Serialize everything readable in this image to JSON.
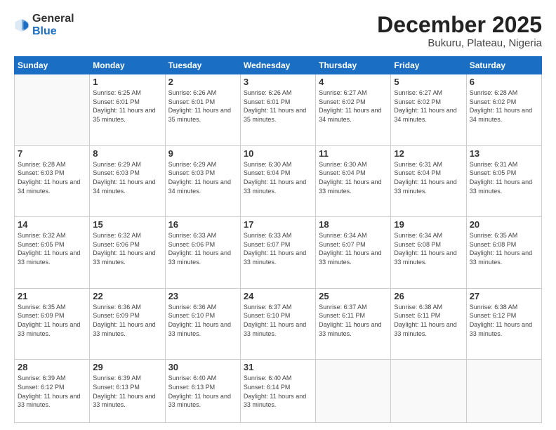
{
  "header": {
    "logo": {
      "text_general": "General",
      "text_blue": "Blue"
    },
    "title": "December 2025",
    "location": "Bukuru, Plateau, Nigeria"
  },
  "weekdays": [
    "Sunday",
    "Monday",
    "Tuesday",
    "Wednesday",
    "Thursday",
    "Friday",
    "Saturday"
  ],
  "weeks": [
    [
      {
        "day": "",
        "info": ""
      },
      {
        "day": "1",
        "info": "Sunrise: 6:25 AM\nSunset: 6:01 PM\nDaylight: 11 hours and 35 minutes."
      },
      {
        "day": "2",
        "info": "Sunrise: 6:26 AM\nSunset: 6:01 PM\nDaylight: 11 hours and 35 minutes."
      },
      {
        "day": "3",
        "info": "Sunrise: 6:26 AM\nSunset: 6:01 PM\nDaylight: 11 hours and 35 minutes."
      },
      {
        "day": "4",
        "info": "Sunrise: 6:27 AM\nSunset: 6:02 PM\nDaylight: 11 hours and 34 minutes."
      },
      {
        "day": "5",
        "info": "Sunrise: 6:27 AM\nSunset: 6:02 PM\nDaylight: 11 hours and 34 minutes."
      },
      {
        "day": "6",
        "info": "Sunrise: 6:28 AM\nSunset: 6:02 PM\nDaylight: 11 hours and 34 minutes."
      }
    ],
    [
      {
        "day": "7",
        "info": "Sunrise: 6:28 AM\nSunset: 6:03 PM\nDaylight: 11 hours and 34 minutes."
      },
      {
        "day": "8",
        "info": "Sunrise: 6:29 AM\nSunset: 6:03 PM\nDaylight: 11 hours and 34 minutes."
      },
      {
        "day": "9",
        "info": "Sunrise: 6:29 AM\nSunset: 6:03 PM\nDaylight: 11 hours and 34 minutes."
      },
      {
        "day": "10",
        "info": "Sunrise: 6:30 AM\nSunset: 6:04 PM\nDaylight: 11 hours and 33 minutes."
      },
      {
        "day": "11",
        "info": "Sunrise: 6:30 AM\nSunset: 6:04 PM\nDaylight: 11 hours and 33 minutes."
      },
      {
        "day": "12",
        "info": "Sunrise: 6:31 AM\nSunset: 6:04 PM\nDaylight: 11 hours and 33 minutes."
      },
      {
        "day": "13",
        "info": "Sunrise: 6:31 AM\nSunset: 6:05 PM\nDaylight: 11 hours and 33 minutes."
      }
    ],
    [
      {
        "day": "14",
        "info": "Sunrise: 6:32 AM\nSunset: 6:05 PM\nDaylight: 11 hours and 33 minutes."
      },
      {
        "day": "15",
        "info": "Sunrise: 6:32 AM\nSunset: 6:06 PM\nDaylight: 11 hours and 33 minutes."
      },
      {
        "day": "16",
        "info": "Sunrise: 6:33 AM\nSunset: 6:06 PM\nDaylight: 11 hours and 33 minutes."
      },
      {
        "day": "17",
        "info": "Sunrise: 6:33 AM\nSunset: 6:07 PM\nDaylight: 11 hours and 33 minutes."
      },
      {
        "day": "18",
        "info": "Sunrise: 6:34 AM\nSunset: 6:07 PM\nDaylight: 11 hours and 33 minutes."
      },
      {
        "day": "19",
        "info": "Sunrise: 6:34 AM\nSunset: 6:08 PM\nDaylight: 11 hours and 33 minutes."
      },
      {
        "day": "20",
        "info": "Sunrise: 6:35 AM\nSunset: 6:08 PM\nDaylight: 11 hours and 33 minutes."
      }
    ],
    [
      {
        "day": "21",
        "info": "Sunrise: 6:35 AM\nSunset: 6:09 PM\nDaylight: 11 hours and 33 minutes."
      },
      {
        "day": "22",
        "info": "Sunrise: 6:36 AM\nSunset: 6:09 PM\nDaylight: 11 hours and 33 minutes."
      },
      {
        "day": "23",
        "info": "Sunrise: 6:36 AM\nSunset: 6:10 PM\nDaylight: 11 hours and 33 minutes."
      },
      {
        "day": "24",
        "info": "Sunrise: 6:37 AM\nSunset: 6:10 PM\nDaylight: 11 hours and 33 minutes."
      },
      {
        "day": "25",
        "info": "Sunrise: 6:37 AM\nSunset: 6:11 PM\nDaylight: 11 hours and 33 minutes."
      },
      {
        "day": "26",
        "info": "Sunrise: 6:38 AM\nSunset: 6:11 PM\nDaylight: 11 hours and 33 minutes."
      },
      {
        "day": "27",
        "info": "Sunrise: 6:38 AM\nSunset: 6:12 PM\nDaylight: 11 hours and 33 minutes."
      }
    ],
    [
      {
        "day": "28",
        "info": "Sunrise: 6:39 AM\nSunset: 6:12 PM\nDaylight: 11 hours and 33 minutes."
      },
      {
        "day": "29",
        "info": "Sunrise: 6:39 AM\nSunset: 6:13 PM\nDaylight: 11 hours and 33 minutes."
      },
      {
        "day": "30",
        "info": "Sunrise: 6:40 AM\nSunset: 6:13 PM\nDaylight: 11 hours and 33 minutes."
      },
      {
        "day": "31",
        "info": "Sunrise: 6:40 AM\nSunset: 6:14 PM\nDaylight: 11 hours and 33 minutes."
      },
      {
        "day": "",
        "info": ""
      },
      {
        "day": "",
        "info": ""
      },
      {
        "day": "",
        "info": ""
      }
    ]
  ]
}
